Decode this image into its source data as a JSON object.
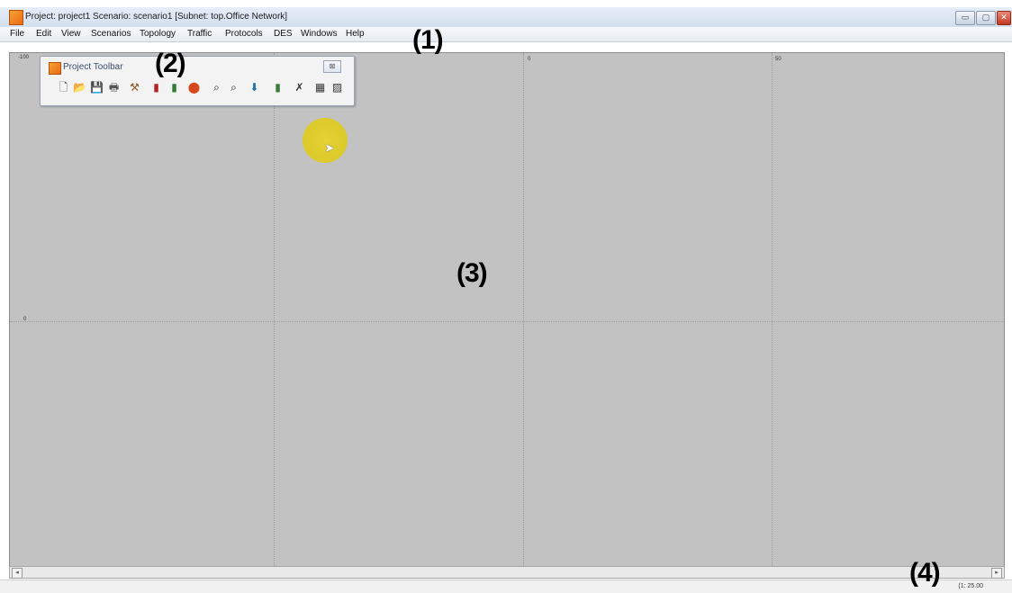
{
  "window": {
    "title": "Project: project1 Scenario: scenario1  [Subnet: top.Office Network]",
    "controls": [
      "▭",
      "▢",
      "✕"
    ]
  },
  "menu": [
    "File",
    "Edit",
    "View",
    "Scenarios",
    "Topology",
    "Traffic",
    "Protocols",
    "DES",
    "Windows",
    "Help"
  ],
  "toolbar_window": {
    "title": "Project Toolbar",
    "close": "⊠",
    "tools": [
      {
        "name": "new-icon",
        "glyph": "🗋",
        "color": "#444"
      },
      {
        "name": "open-folder-icon",
        "glyph": "📂",
        "color": "#c98a12"
      },
      {
        "name": "save-icon",
        "glyph": "💾",
        "color": "#2a4a8c"
      },
      {
        "name": "print-icon",
        "glyph": "🖶",
        "color": "#555"
      },
      {
        "name": "object-palette-icon",
        "glyph": "⚒",
        "color": "#8a5a20"
      },
      {
        "name": "configure-traffic-icon",
        "glyph": "▮",
        "color": "#b22222"
      },
      {
        "name": "deploy-app-icon",
        "glyph": "▮",
        "color": "#2e7d32"
      },
      {
        "name": "failure-icon",
        "glyph": "⬤",
        "color": "#d44a1c"
      },
      {
        "name": "zoom-in-icon",
        "glyph": "⌕",
        "color": "#222"
      },
      {
        "name": "zoom-out-icon",
        "glyph": "⌕",
        "color": "#222"
      },
      {
        "name": "link-icon",
        "glyph": "⬇",
        "color": "#1b6ea8"
      },
      {
        "name": "battery-icon",
        "glyph": "▮",
        "color": "#3c7a3c"
      },
      {
        "name": "edit-node-icon",
        "glyph": "✗",
        "color": "#333"
      },
      {
        "name": "view-results-icon",
        "glyph": "▦",
        "color": "#333"
      },
      {
        "name": "web-report-icon",
        "glyph": "▨",
        "color": "#333"
      }
    ]
  },
  "canvas": {
    "ticks": {
      "top_left": "-100",
      "top_mid": "0",
      "top_right": "50",
      "left_mid": "0"
    }
  },
  "status": {
    "coords": "(1: 25.00"
  },
  "annotations": {
    "a1": "(1)",
    "a2": "(2)",
    "a3": "(3)",
    "a4": "(4)"
  },
  "scroll": {
    "left": "◂",
    "right": "▸"
  }
}
